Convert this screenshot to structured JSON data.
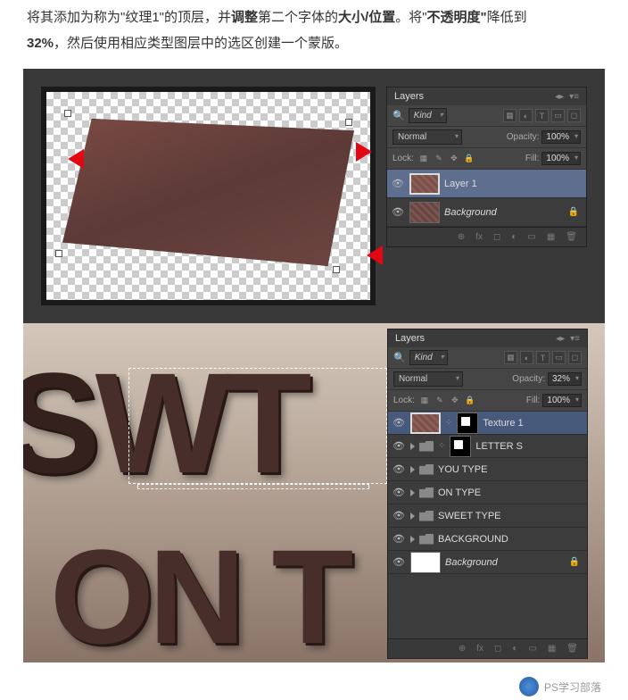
{
  "instruction": {
    "part1": "将其添加为称为\"纹理1\"的顶层，并",
    "bold1": "调整",
    "part2": "第二个字体的",
    "bold2": "大小/位置",
    "part3": "。将\"",
    "bold3": "不透明度\"",
    "part4": "降低到",
    "bold4": "32%",
    "part5": "，然后使用相应类型图层中的选区创建一个蒙版。"
  },
  "panel1": {
    "title": "Layers",
    "kind": "Kind",
    "blend": "Normal",
    "opacity_label": "Opacity:",
    "opacity": "100%",
    "lock_label": "Lock:",
    "fill_label": "Fill:",
    "fill": "100%",
    "layers": [
      {
        "name": "Layer 1",
        "sel": true,
        "tex": true
      },
      {
        "name": "Background",
        "italic": true,
        "locked": true
      }
    ]
  },
  "panel2": {
    "title": "Layers",
    "kind": "Kind",
    "blend": "Normal",
    "opacity_label": "Opacity:",
    "opacity": "32%",
    "lock_label": "Lock:",
    "fill_label": "Fill:",
    "fill": "100%",
    "layers": [
      {
        "name": "Texture 1",
        "type": "tex",
        "sel": true,
        "mask": true
      },
      {
        "name": "LETTER S",
        "type": "folder",
        "mask": true
      },
      {
        "name": "YOU TYPE",
        "type": "folder"
      },
      {
        "name": "ON TYPE",
        "type": "folder"
      },
      {
        "name": "SWEET TYPE",
        "type": "folder"
      },
      {
        "name": "BACKGROUND",
        "type": "folder"
      },
      {
        "name": "Background",
        "type": "white",
        "italic": true,
        "locked": true
      }
    ]
  },
  "bigtext": {
    "line1a": "S",
    "line1b": "WT",
    "line2": "ON T"
  },
  "footer": "PS学习部落"
}
